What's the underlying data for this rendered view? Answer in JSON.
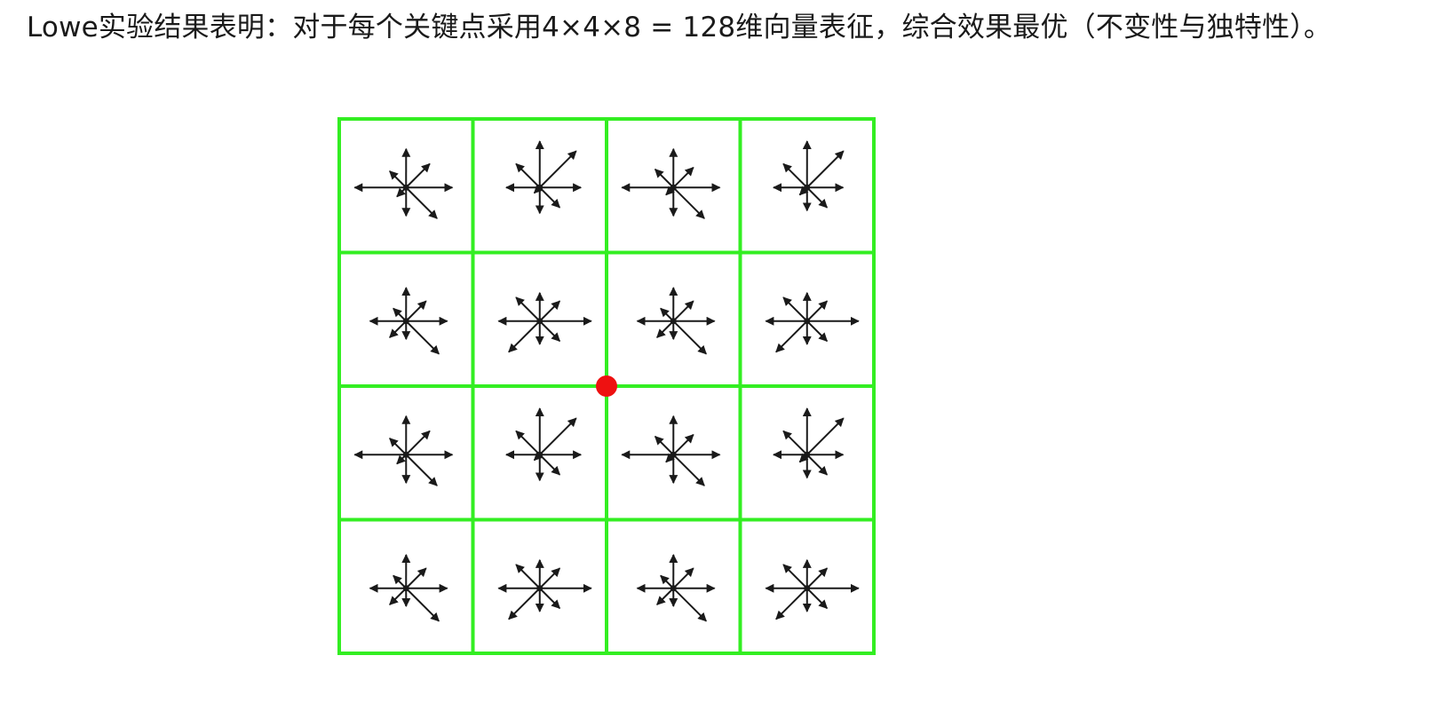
{
  "caption": {
    "text": "Lowe实验结果表明：对于每个关键点采用4×4×8 = 128维向量表征，综合效果最优（不变性与独特性）。"
  },
  "figure": {
    "colors": {
      "grid": "#33ee22",
      "arrow": "#1a1a1a",
      "keypoint": "#ee1111",
      "background": "#ffffff"
    },
    "grid_rows": 4,
    "grid_cols": 4,
    "bins_per_cell": 8,
    "bin_directions": [
      "E",
      "NE",
      "N",
      "NW",
      "W",
      "SW",
      "S",
      "SE"
    ],
    "cells": [
      {
        "row": 0,
        "col": 0,
        "magnitudes": [
          0.9,
          0.65,
          0.75,
          0.45,
          1.0,
          0.25,
          0.55,
          0.85
        ]
      },
      {
        "row": 0,
        "col": 1,
        "magnitudes": [
          0.8,
          1.0,
          0.9,
          0.65,
          0.65,
          0.15,
          0.5,
          0.55
        ]
      },
      {
        "row": 0,
        "col": 2,
        "magnitudes": [
          0.9,
          0.55,
          0.75,
          0.5,
          1.0,
          0.2,
          0.55,
          0.85
        ]
      },
      {
        "row": 0,
        "col": 3,
        "magnitudes": [
          0.7,
          1.0,
          0.9,
          0.65,
          0.65,
          0.2,
          0.45,
          0.55
        ]
      },
      {
        "row": 1,
        "col": 0,
        "magnitudes": [
          0.8,
          0.55,
          0.65,
          0.35,
          0.7,
          0.45,
          0.35,
          0.9
        ]
      },
      {
        "row": 1,
        "col": 1,
        "magnitudes": [
          1.0,
          0.55,
          0.55,
          0.65,
          0.8,
          0.85,
          0.45,
          0.55
        ]
      },
      {
        "row": 1,
        "col": 2,
        "magnitudes": [
          0.8,
          0.55,
          0.65,
          0.35,
          0.7,
          0.45,
          0.35,
          0.9
        ]
      },
      {
        "row": 1,
        "col": 3,
        "magnitudes": [
          1.0,
          0.55,
          0.55,
          0.65,
          0.8,
          0.85,
          0.45,
          0.55
        ]
      },
      {
        "row": 2,
        "col": 0,
        "magnitudes": [
          0.9,
          0.65,
          0.75,
          0.45,
          1.0,
          0.25,
          0.55,
          0.85
        ]
      },
      {
        "row": 2,
        "col": 1,
        "magnitudes": [
          0.8,
          1.0,
          0.9,
          0.65,
          0.65,
          0.15,
          0.5,
          0.55
        ]
      },
      {
        "row": 2,
        "col": 2,
        "magnitudes": [
          0.9,
          0.55,
          0.75,
          0.5,
          1.0,
          0.2,
          0.55,
          0.85
        ]
      },
      {
        "row": 2,
        "col": 3,
        "magnitudes": [
          0.7,
          1.0,
          0.9,
          0.65,
          0.65,
          0.2,
          0.45,
          0.55
        ]
      },
      {
        "row": 3,
        "col": 0,
        "magnitudes": [
          0.8,
          0.55,
          0.65,
          0.35,
          0.7,
          0.45,
          0.35,
          0.9
        ]
      },
      {
        "row": 3,
        "col": 1,
        "magnitudes": [
          1.0,
          0.55,
          0.55,
          0.65,
          0.8,
          0.85,
          0.45,
          0.55
        ]
      },
      {
        "row": 3,
        "col": 2,
        "magnitudes": [
          0.8,
          0.55,
          0.65,
          0.35,
          0.7,
          0.45,
          0.35,
          0.9
        ]
      },
      {
        "row": 3,
        "col": 3,
        "magnitudes": [
          1.0,
          0.55,
          0.55,
          0.65,
          0.8,
          0.85,
          0.45,
          0.55
        ]
      }
    ]
  }
}
